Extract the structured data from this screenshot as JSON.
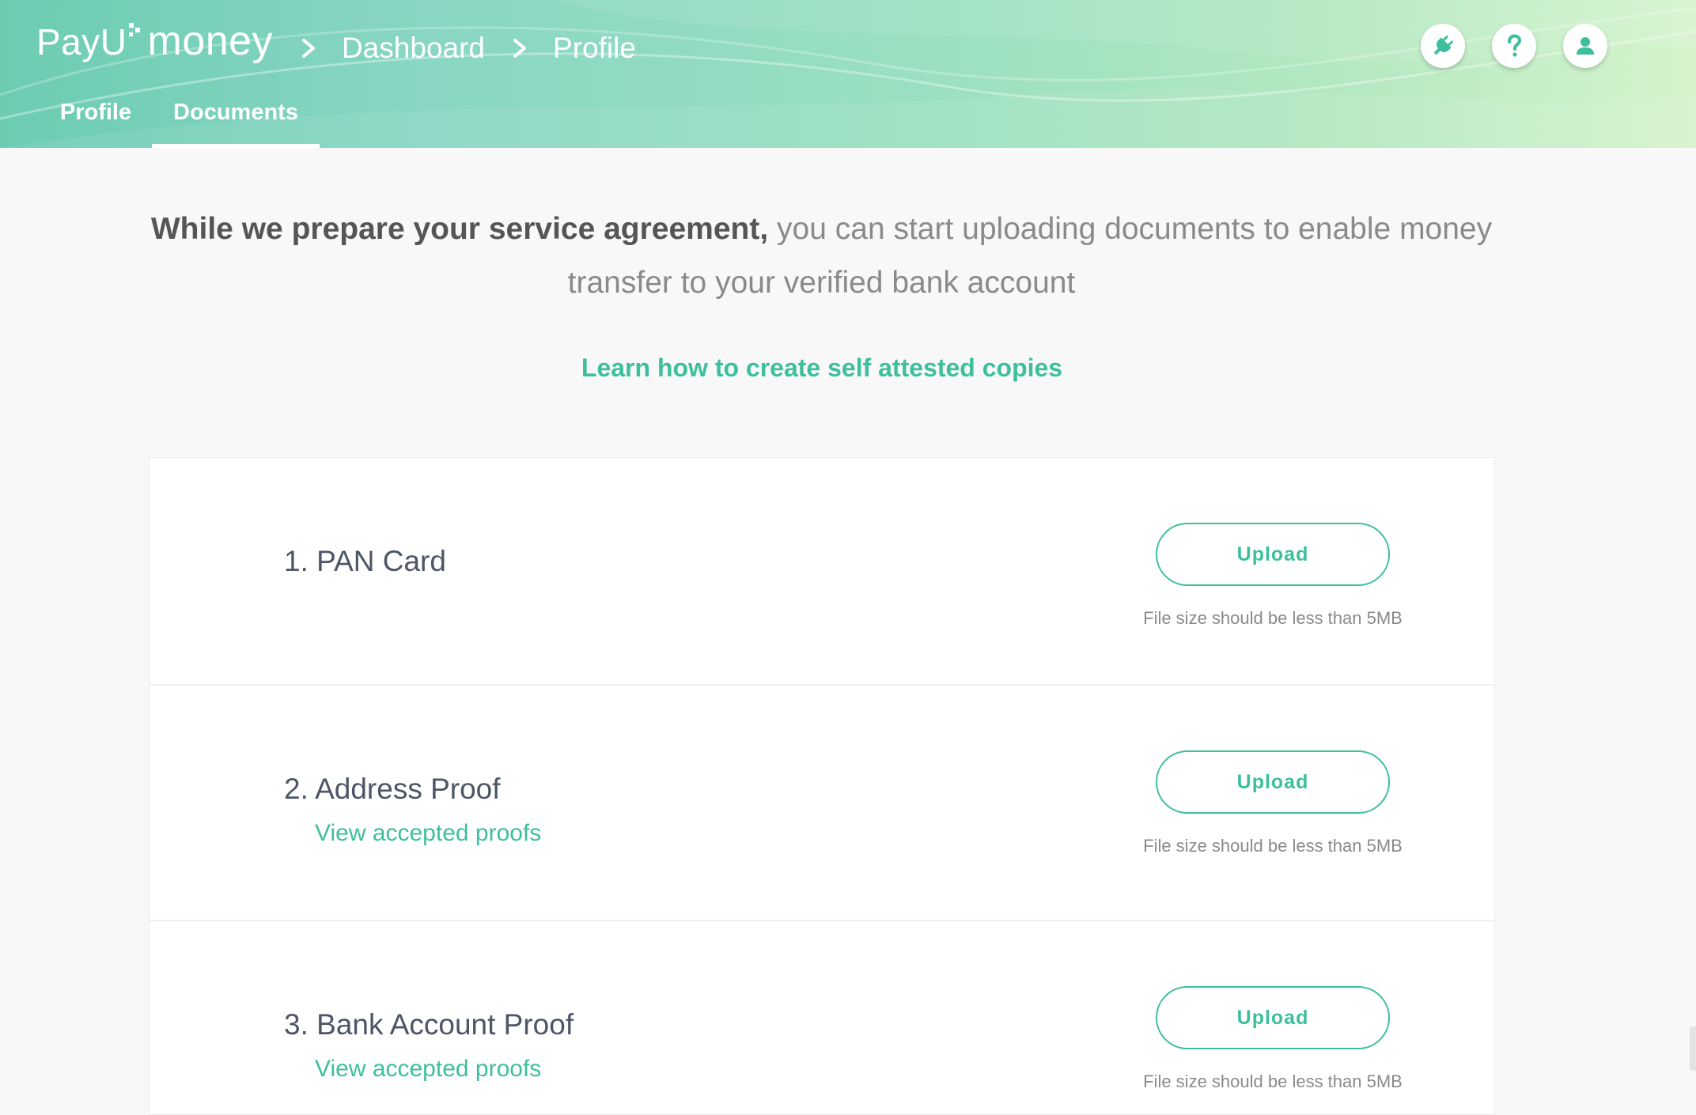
{
  "app": {
    "logo": {
      "pay": "Pay",
      "u": "U",
      "money": "money"
    }
  },
  "breadcrumb": [
    {
      "label": "Dashboard"
    },
    {
      "label": "Profile"
    }
  ],
  "header_icons": [
    {
      "name": "plug-icon"
    },
    {
      "name": "help-icon"
    },
    {
      "name": "user-icon"
    }
  ],
  "tabs": [
    {
      "label": "Profile",
      "active": false
    },
    {
      "label": "Documents",
      "active": true
    }
  ],
  "intro": {
    "strong": "While we prepare your service agreement,",
    "rest": " you can start uploading documents to enable money transfer to your verified bank account"
  },
  "learn_link": "Learn how to create self attested copies",
  "documents": [
    {
      "title": "1. PAN Card",
      "link": "",
      "upload_label": "Upload",
      "note": "File size should be less than 5MB"
    },
    {
      "title": "2. Address Proof",
      "link": "View accepted proofs",
      "upload_label": "Upload",
      "note": "File size should be less than 5MB"
    },
    {
      "title": "3. Bank Account Proof",
      "link": "View accepted proofs",
      "upload_label": "Upload",
      "note": "File size should be less than 5MB"
    }
  ],
  "colors": {
    "accent": "#3dbf9d",
    "header_start": "#6cccb2",
    "header_end": "#d6f3cd",
    "background": "#f8f8f8",
    "title_text": "#4d5566"
  }
}
